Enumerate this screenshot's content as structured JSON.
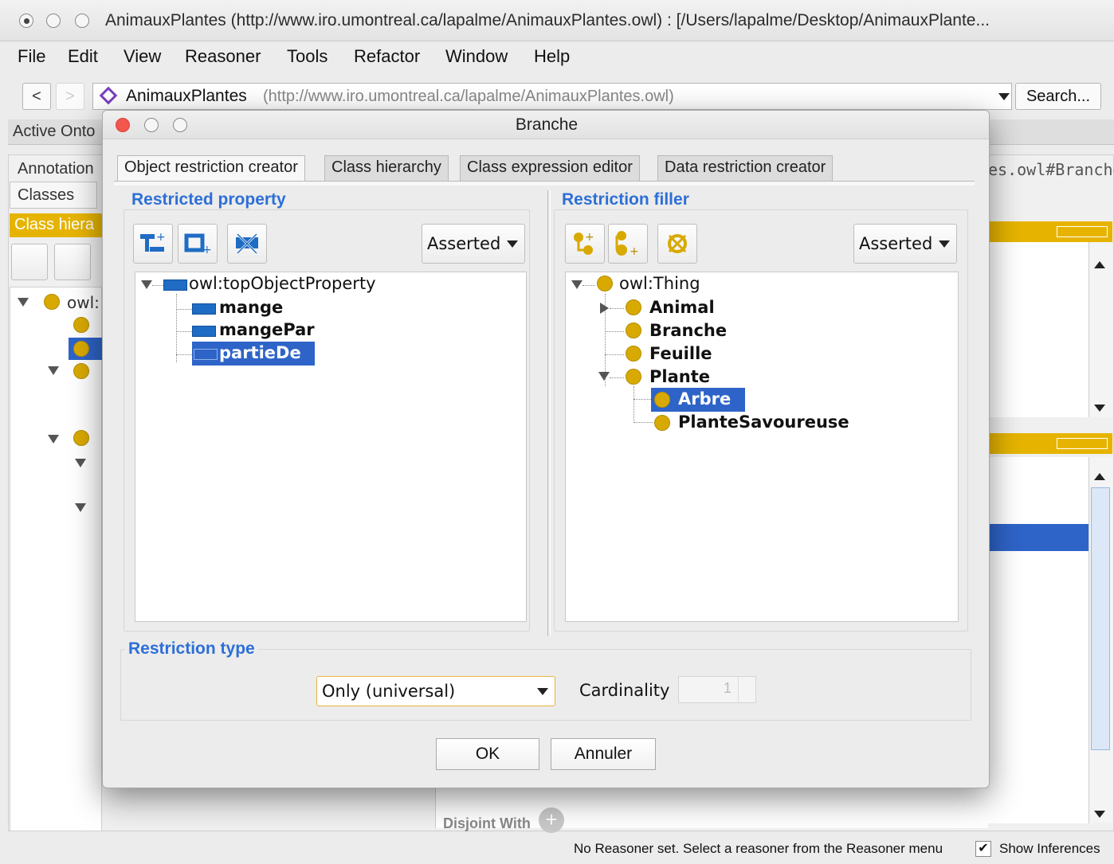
{
  "window": {
    "title": "AnimauxPlantes (http://www.iro.umontreal.ca/lapalme/AnimauxPlantes.owl)  : [/Users/lapalme/Desktop/AnimauxPlante...",
    "menu": [
      "File",
      "Edit",
      "View",
      "Reasoner",
      "Tools",
      "Refactor",
      "Window",
      "Help"
    ],
    "nav_back": "<",
    "ontology_name": "AnimauxPlantes",
    "ontology_url": "(http://www.iro.umontreal.ca/lapalme/AnimauxPlantes.owl)",
    "search_label": "Search..."
  },
  "background": {
    "active_ontology_tab": "Active Onto",
    "annotations_tab": "Annotation",
    "classes_tab": "Classes",
    "class_hierarchy_bar": "Class hiera",
    "iri_text": "es.owl#Branche",
    "tree_root": "owl:",
    "disjoint_with": "Disjoint With",
    "status_text": "No Reasoner set. Select a reasoner from the Reasoner menu",
    "show_inferences": "Show Inferences"
  },
  "dialog": {
    "title": "Branche",
    "tabs": [
      "Object restriction creator",
      "Class hierarchy",
      "Class expression editor",
      "Data restriction creator"
    ],
    "restricted_property": {
      "title": "Restricted property",
      "mode": "Asserted",
      "root": "owl:topObjectProperty",
      "items": [
        "mange",
        "mangePar",
        "partieDe"
      ],
      "selected": "partieDe"
    },
    "restriction_filler": {
      "title": "Restriction filler",
      "mode": "Asserted",
      "root": "owl:Thing",
      "items": [
        "Animal",
        "Branche",
        "Feuille",
        "Plante"
      ],
      "plante_children": [
        "Arbre",
        "PlanteSavoureuse"
      ],
      "selected": "Arbre"
    },
    "restriction_type": {
      "title": "Restriction type",
      "value": "Only (universal)",
      "cardinality_label": "Cardinality",
      "cardinality_value": "1"
    },
    "ok_label": "OK",
    "cancel_label": "Annuler"
  },
  "colors": {
    "section_title": "#2d6fd6",
    "selection": "#2e64c8",
    "class_dot": "#d8a900",
    "property_bar": "#1f6cc4",
    "panel_bar": "#e6b400"
  }
}
